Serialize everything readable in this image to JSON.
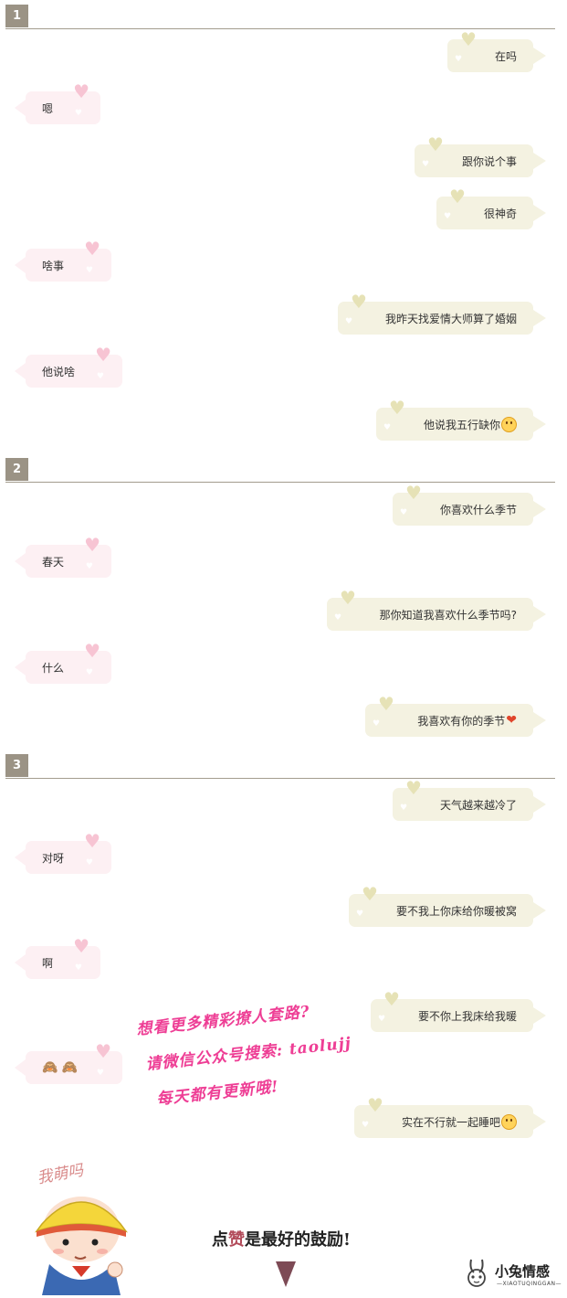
{
  "sections": [
    {
      "number": "1",
      "messages": [
        {
          "side": "right",
          "text": "在吗"
        },
        {
          "side": "left",
          "text": "嗯"
        },
        {
          "side": "right",
          "text": "跟你说个事"
        },
        {
          "side": "right",
          "text": "很神奇"
        },
        {
          "side": "left",
          "text": "啥事"
        },
        {
          "side": "right",
          "text": "我昨天找爱情大师算了婚姻"
        },
        {
          "side": "left",
          "text": "他说啥"
        },
        {
          "side": "right",
          "text": "他说我五行缺你",
          "emoji": "smile-emoji"
        }
      ]
    },
    {
      "number": "2",
      "messages": [
        {
          "side": "right",
          "text": "你喜欢什么季节"
        },
        {
          "side": "left",
          "text": "春天"
        },
        {
          "side": "right",
          "text": "那你知道我喜欢什么季节吗?"
        },
        {
          "side": "left",
          "text": "什么"
        },
        {
          "side": "right",
          "text": "我喜欢有你的季节",
          "emoji": "heart-emoji"
        }
      ]
    },
    {
      "number": "3",
      "messages": [
        {
          "side": "right",
          "text": "天气越来越冷了"
        },
        {
          "side": "left",
          "text": "对呀"
        },
        {
          "side": "right",
          "text": "要不我上你床给你暖被窝"
        },
        {
          "side": "left",
          "text": "啊"
        },
        {
          "side": "right",
          "text": "要不你上我床给我暖"
        },
        {
          "side": "left",
          "text": "",
          "emoji": "cat-emoji"
        },
        {
          "side": "right",
          "text": "实在不行就一起睡吧",
          "emoji": "blush-emoji"
        }
      ]
    }
  ],
  "promo": {
    "line1": "想看更多精彩撩人套路?",
    "line2": "请微信公众号搜索: taolujj",
    "line3": "每天都有更新哦!"
  },
  "footer": {
    "cute_label": "我萌吗",
    "cta_prefix": "点",
    "cta_highlight": "赞",
    "cta_suffix": "是最好的鼓励!",
    "brand_name": "小兔情感",
    "brand_sub": "—XIAOTUQINGGAN—"
  },
  "colors": {
    "right_bubble": "#f4f2e1",
    "left_bubble": "#fdf0f3",
    "section_badge": "#9b9385",
    "promo_text": "#ee3e95"
  }
}
